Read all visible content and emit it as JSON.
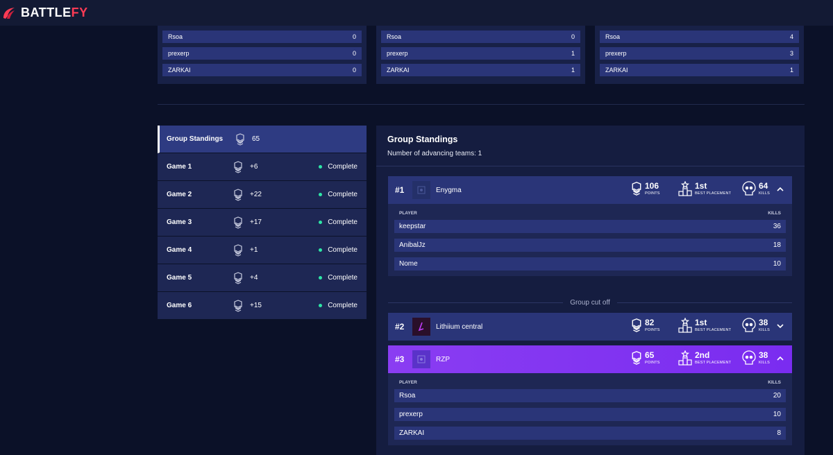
{
  "brand": {
    "name_prefix": "BATTLE",
    "name_suffix": "FY"
  },
  "previous_games": [
    {
      "rows": [
        {
          "name": "Rsoa",
          "kills": "0"
        },
        {
          "name": "prexerp",
          "kills": "0"
        },
        {
          "name": "ZARKAI",
          "kills": "0"
        }
      ]
    },
    {
      "rows": [
        {
          "name": "Rsoa",
          "kills": "0"
        },
        {
          "name": "prexerp",
          "kills": "1"
        },
        {
          "name": "ZARKAI",
          "kills": "1"
        }
      ]
    },
    {
      "rows": [
        {
          "name": "Rsoa",
          "kills": "4"
        },
        {
          "name": "prexerp",
          "kills": "3"
        },
        {
          "name": "ZARKAI",
          "kills": "1"
        }
      ]
    }
  ],
  "game_list": [
    {
      "label": "Group Standings",
      "points": "65",
      "status": ""
    },
    {
      "label": "Game 1",
      "points": "+6",
      "status": "Complete"
    },
    {
      "label": "Game 2",
      "points": "+22",
      "status": "Complete"
    },
    {
      "label": "Game 3",
      "points": "+17",
      "status": "Complete"
    },
    {
      "label": "Game 4",
      "points": "+1",
      "status": "Complete"
    },
    {
      "label": "Game 5",
      "points": "+4",
      "status": "Complete"
    },
    {
      "label": "Game 6",
      "points": "+15",
      "status": "Complete"
    }
  ],
  "standings": {
    "title": "Group Standings",
    "subtitle": "Number of advancing teams: 1",
    "cutoff_label": "Group cut off",
    "labels": {
      "points": "POINTS",
      "best_placement": "BEST PLACEMENT",
      "kills": "KILLS",
      "player": "PLAYER",
      "kills_col": "KILLS"
    },
    "teams": [
      {
        "rank": "#1",
        "name": "Enygma",
        "points": "106",
        "best": "1st",
        "kills": "64",
        "chevron": "^",
        "players": [
          {
            "name": "keepstar",
            "kills": "36"
          },
          {
            "name": "AnibalJz",
            "kills": "18"
          },
          {
            "name": "Nome",
            "kills": "10"
          }
        ]
      },
      {
        "rank": "#2",
        "name": "Lithiium central",
        "points": "82",
        "best": "1st",
        "kills": "38",
        "chevron": "v",
        "players": []
      },
      {
        "rank": "#3",
        "name": "RZP",
        "points": "65",
        "best": "2nd",
        "kills": "38",
        "chevron": "^",
        "players": [
          {
            "name": "Rsoa",
            "kills": "20"
          },
          {
            "name": "prexerp",
            "kills": "10"
          },
          {
            "name": "ZARKAI",
            "kills": "8"
          }
        ]
      }
    ]
  },
  "colors": {
    "accent": "#ff3b55",
    "highlight": "#8a3df2",
    "status_complete": "#2ee6a6"
  }
}
